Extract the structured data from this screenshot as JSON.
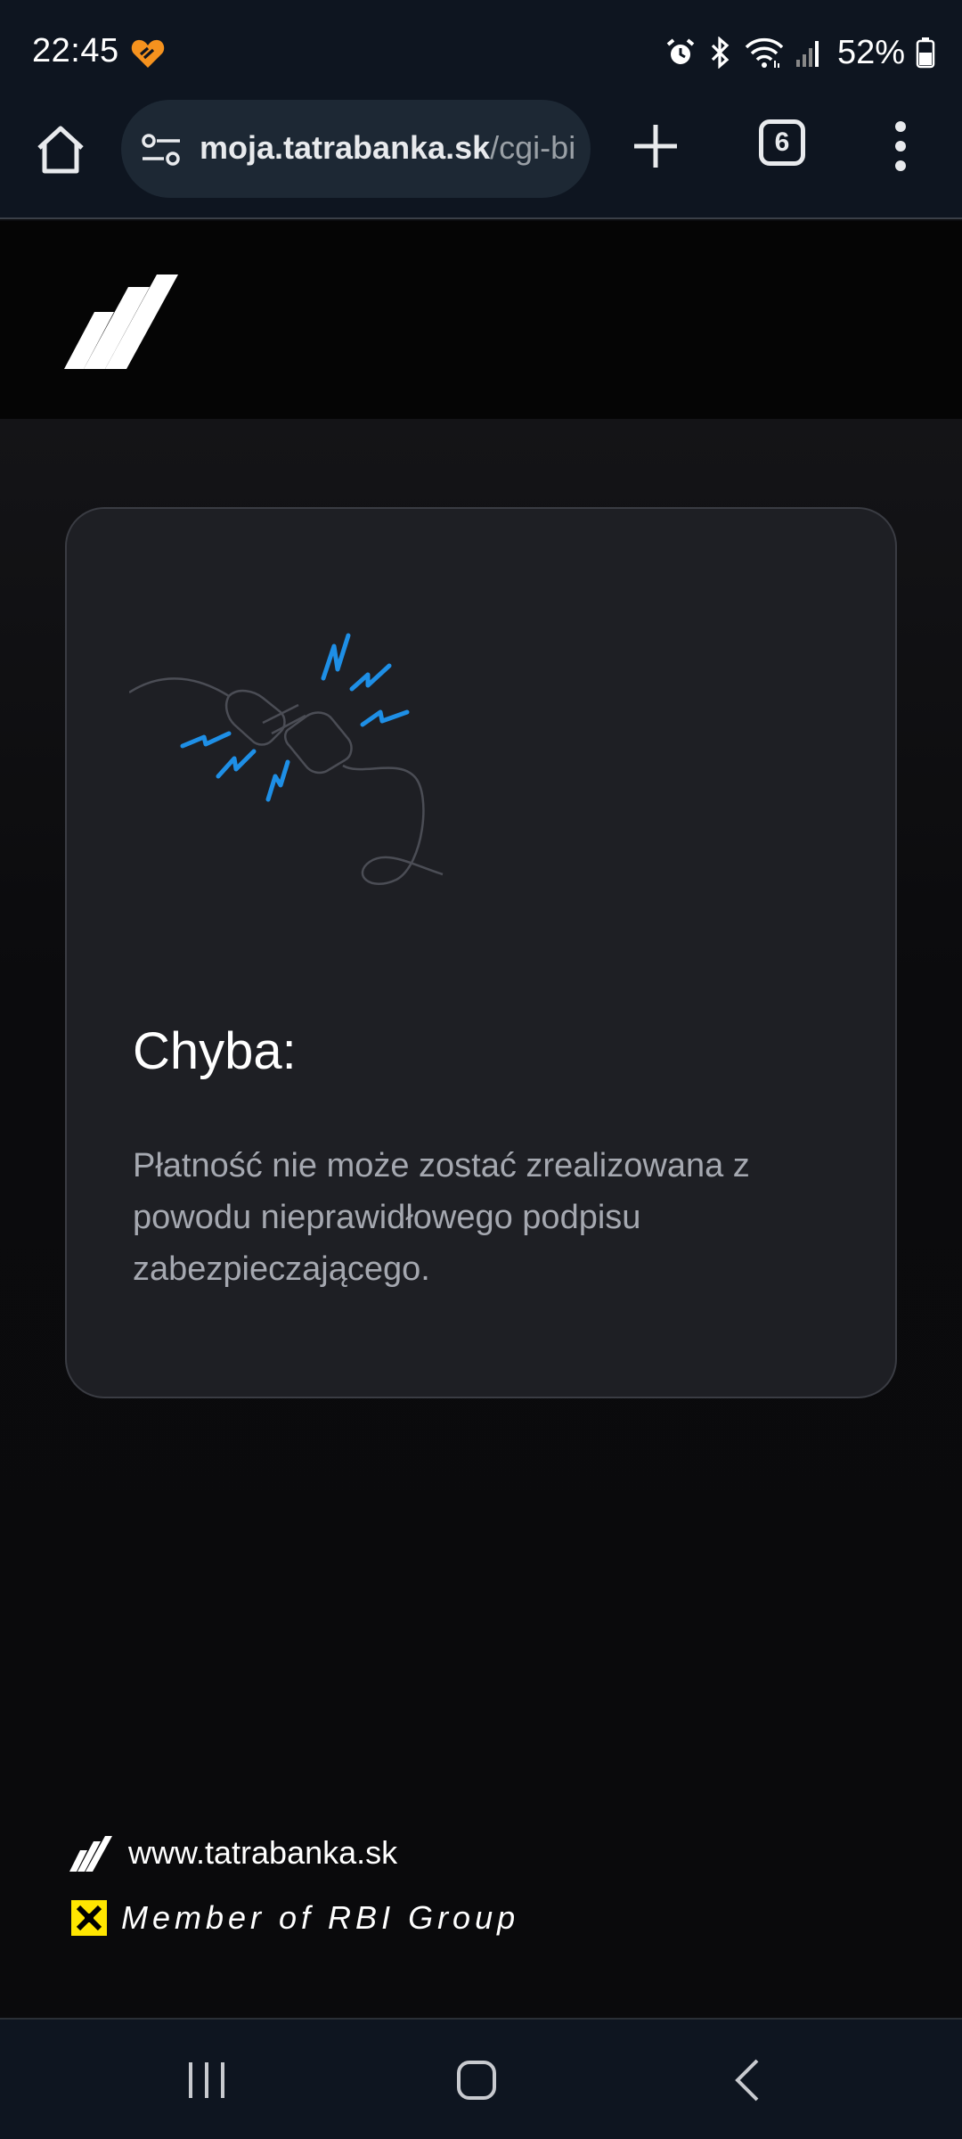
{
  "status_bar": {
    "time": "22:45",
    "battery_percent": "52%",
    "icons": [
      "heart-shield-icon",
      "alarm-icon",
      "bluetooth-icon",
      "wifi-icon",
      "signal-icon",
      "battery-icon"
    ]
  },
  "browser": {
    "url_bold": "moja.tatrabanka.sk",
    "url_rest": "/cgi-bi",
    "tab_count": "6",
    "icons": [
      "home-icon",
      "tune-icon",
      "plus-icon",
      "tabs-icon",
      "more-vert-icon"
    ]
  },
  "error_card": {
    "title": "Chyba:",
    "message": "Płatność nie może zostać zrealizowana z powodu nieprawidłowego podpisu zabezpieczającego."
  },
  "footer": {
    "website": "www.tatrabanka.sk",
    "member": "Member of RBI Group"
  },
  "colors": {
    "spark_blue": "#1e8fe6",
    "rbi_yellow": "#ffe600",
    "card_bg": "#1e1f24"
  }
}
